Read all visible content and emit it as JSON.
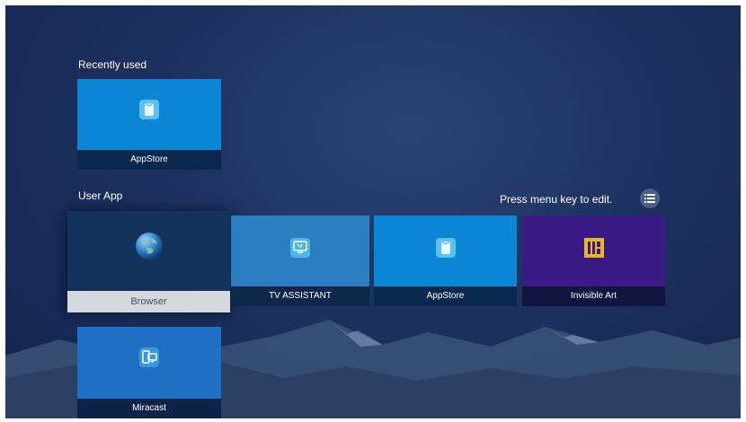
{
  "recently_used": {
    "title": "Recently used",
    "tiles": [
      {
        "label": "AppStore",
        "color": "#0a86d4",
        "icon": "appstore-icon"
      }
    ]
  },
  "user_app": {
    "title": "User App",
    "hint": "Press menu key to edit.",
    "menu_icon": "menu-list-icon",
    "tiles": [
      {
        "label": "Browser",
        "focused": true,
        "color": "#13325c",
        "icon": "globe-icon"
      },
      {
        "label": "TV ASSISTANT",
        "color": "#2b7fc0",
        "icon": "tv-assistant-icon"
      },
      {
        "label": "AppStore",
        "color": "#0a86d4",
        "icon": "appstore-icon"
      },
      {
        "label": "Invisible Art",
        "color": "#3a1a85",
        "icon": "invisible-art-icon"
      },
      {
        "label": "Miracast",
        "color": "#1f6fc2",
        "icon": "miracast-icon"
      }
    ]
  }
}
